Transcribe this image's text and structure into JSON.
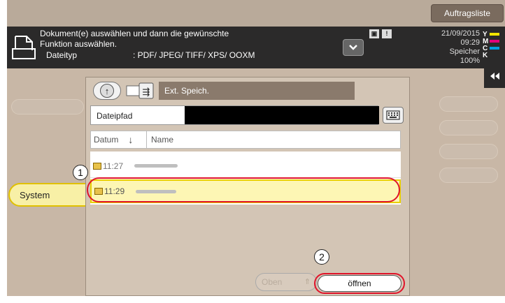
{
  "topbar": {
    "job_list_label": "Auftragsliste"
  },
  "header": {
    "message_line1": "Dokument(e) auswählen und dann die gewünschte",
    "message_line2": "Funktion auswählen.",
    "filetype_label": "Dateityp",
    "filetype_value": ": PDF/ JPEG/ TIFF/ XPS/ OOXM",
    "date": "21/09/2015",
    "time": "09:29",
    "memory_label": "Speicher",
    "memory_value": "100%",
    "toner": [
      {
        "letter": "Y",
        "color": "#f2e400"
      },
      {
        "letter": "M",
        "color": "#e2007a"
      },
      {
        "letter": "C",
        "color": "#00a0e0"
      },
      {
        "letter": "K",
        "color": "#222222"
      }
    ]
  },
  "side_tab": {
    "label": "System"
  },
  "dialog": {
    "storage_label": "Ext. Speich.",
    "path_label": "Dateipfad",
    "path_value": "",
    "columns": {
      "date": "Datum",
      "name": "Name"
    },
    "rows": [
      {
        "time": "11:27",
        "selected": false
      },
      {
        "time": "11:29",
        "selected": true
      }
    ],
    "top_button": "Oben",
    "open_button": "öffnen"
  },
  "callouts": {
    "one": "1",
    "two": "2"
  },
  "colors": {
    "accent_red": "#e0142a",
    "selection_yellow": "#fdf6b4",
    "panel_beige": "#c8b7a6",
    "header_dark": "#2b2a2a"
  }
}
